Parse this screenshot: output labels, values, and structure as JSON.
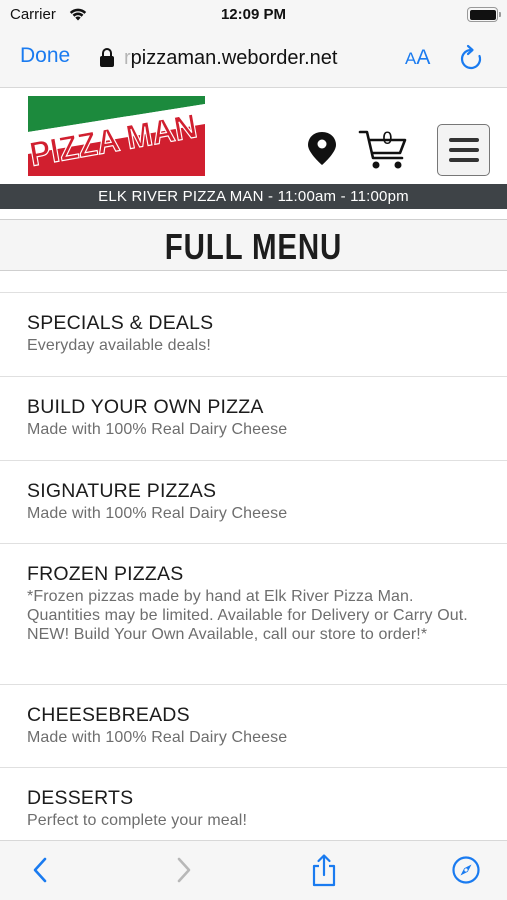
{
  "status_bar": {
    "carrier": "Carrier",
    "time": "12:09 PM",
    "battery_level": 1.0
  },
  "browser": {
    "done_label": "Done",
    "url_prefix": "r",
    "url": "pizzaman.weborder.net",
    "text_size_small": "A",
    "text_size_large": "A",
    "accent_color": "#1a7bf0"
  },
  "header": {
    "logo_text": "PIZZA MAN",
    "logo_colors": {
      "green": "#1c8a3d",
      "white": "#ffffff",
      "red": "#d11f2f"
    },
    "cart_count": "0",
    "location_icon": "map-pin-icon",
    "cart_icon": "shopping-cart-icon",
    "menu_icon": "hamburger-menu-icon"
  },
  "hours_bar": {
    "text": "ELK RIVER PIZZA MAN - 11:00am - 11:00pm"
  },
  "page_title": "FULL MENU",
  "menu": {
    "items": [
      {
        "name": "SPECIALS & DEALS",
        "description": "Everyday available deals!"
      },
      {
        "name": "BUILD YOUR OWN PIZZA",
        "description": "Made with 100% Real Dairy Cheese"
      },
      {
        "name": "SIGNATURE PIZZAS",
        "description": "Made with 100% Real Dairy Cheese"
      },
      {
        "name": "FROZEN PIZZAS",
        "description": "*Frozen pizzas made by hand at Elk River Pizza Man. Quantities may be limited. Available for Delivery or Carry Out. NEW! Build Your Own Available, call our store to order!*"
      },
      {
        "name": "CHEESEBREADS",
        "description": "Made with 100% Real Dairy Cheese"
      },
      {
        "name": "DESSERTS",
        "description": "Perfect to complete your meal!"
      }
    ]
  },
  "toolbar": {
    "back_icon": "chevron-left-icon",
    "forward_icon": "chevron-right-icon",
    "share_icon": "share-icon",
    "browser_icon": "compass-icon"
  }
}
